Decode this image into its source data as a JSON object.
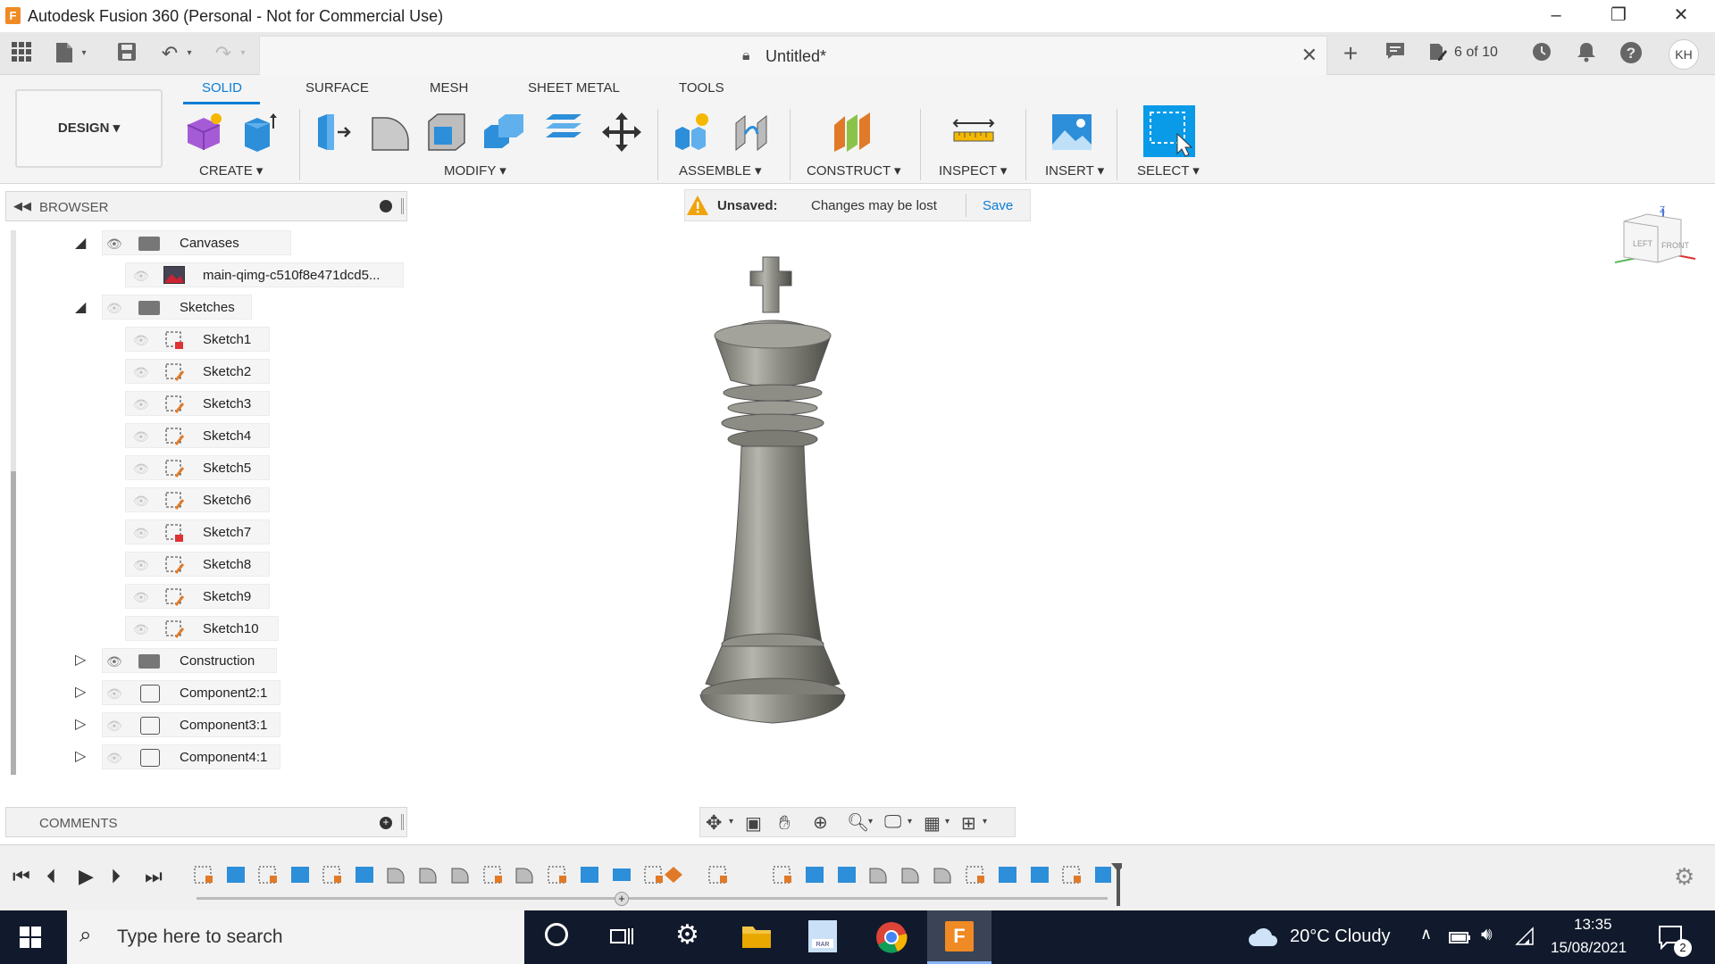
{
  "window": {
    "title": "Autodesk Fusion 360 (Personal - Not for Commercial Use)",
    "app_icon_letter": "F"
  },
  "qat": {
    "doc_title": "Untitled*",
    "version": "6 of 10",
    "user_initials": "KH"
  },
  "ribbon": {
    "workspace": "DESIGN ▾",
    "tabs": [
      "SOLID",
      "SURFACE",
      "MESH",
      "SHEET METAL",
      "TOOLS"
    ],
    "active_tab": "SOLID",
    "groups": [
      "CREATE ▾",
      "MODIFY ▾",
      "ASSEMBLE ▾",
      "CONSTRUCT ▾",
      "INSPECT ▾",
      "INSERT ▾",
      "SELECT ▾"
    ]
  },
  "browser": {
    "title": "BROWSER",
    "canvases_label": "Canvases",
    "canvas_item": "main-qimg-c510f8e471dcd5...",
    "sketches_label": "Sketches",
    "sketches": [
      "Sketch1",
      "Sketch2",
      "Sketch3",
      "Sketch4",
      "Sketch5",
      "Sketch6",
      "Sketch7",
      "Sketch8",
      "Sketch9",
      "Sketch10"
    ],
    "construction_label": "Construction",
    "components": [
      "Component2:1",
      "Component3:1",
      "Component4:1"
    ]
  },
  "unsaved": {
    "label": "Unsaved:",
    "message": "Changes may be lost",
    "save": "Save"
  },
  "comments": {
    "title": "COMMENTS"
  },
  "viewcube": {
    "left": "LEFT",
    "front": "FRONT",
    "z": "Z"
  },
  "taskbar": {
    "search_placeholder": "Type here to search",
    "weather": "20°C  Cloudy",
    "time": "13:35",
    "date": "15/08/2021",
    "notif_count": "2"
  },
  "colors": {
    "accent": "#0a7dd6",
    "taskbar": "#111a2c",
    "warning": "#f0a30a"
  }
}
